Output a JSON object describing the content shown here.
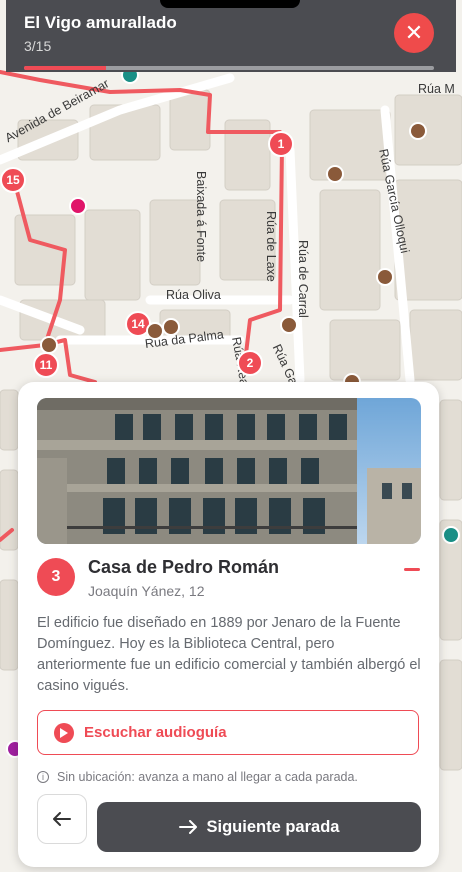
{
  "tour": {
    "title": "El Vigo amurallado",
    "counter": "3/15",
    "progress_fraction": 0.2
  },
  "map": {
    "streets": [
      "Avenida de Beiramar",
      "Rúa M",
      "Baixada á Fonte",
      "Rúa de Laxe",
      "Rúa de Carral",
      "Rúa García Olloqui",
      "Rúa Oliva",
      "Rúa da Palma",
      "Rúa Gamb",
      "Rúa Real"
    ],
    "route_markers": [
      "1",
      "2",
      "11",
      "14",
      "15"
    ],
    "colors": {
      "route": "#ef5a60",
      "marker": "#ef4b55",
      "poi": "#8a5a3a"
    }
  },
  "stop": {
    "number": "3",
    "name": "Casa de Pedro Román",
    "address": "Joaquín Yánez, 12",
    "description": "El edificio fue diseñado en 1889 por Jenaro de la Fuente Domínguez. Hoy es la Biblioteca Central, pero anteriormente fue un edificio comercial y también albergó el casino vigués."
  },
  "actions": {
    "audio_label": "Escuchar audioguía",
    "location_note": "Sin ubicación: avanza a mano al llegar a cada parada.",
    "next_label": "Siguiente parada"
  },
  "icons": {
    "close": "close-icon",
    "play": "play-icon",
    "info": "info-icon",
    "back": "arrow-left-icon",
    "next": "arrow-right-icon"
  }
}
